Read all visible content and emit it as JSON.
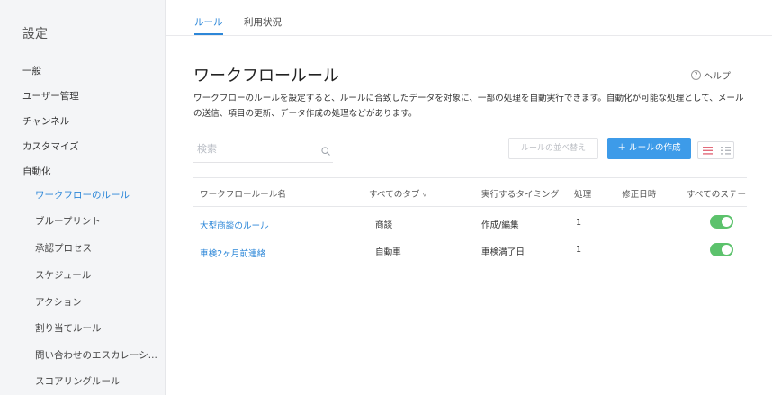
{
  "sidebar": {
    "title": "設定",
    "items": [
      {
        "label": "一般"
      },
      {
        "label": "ユーザー管理"
      },
      {
        "label": "チャンネル"
      },
      {
        "label": "カスタマイズ"
      },
      {
        "label": "自動化"
      }
    ],
    "sub_items": [
      {
        "label": "ワークフローのルール",
        "active": true
      },
      {
        "label": "ブループリント"
      },
      {
        "label": "承認プロセス"
      },
      {
        "label": "スケジュール"
      },
      {
        "label": "アクション"
      },
      {
        "label": "割り当てルール"
      },
      {
        "label": "問い合わせのエスカレーシ..."
      },
      {
        "label": "スコアリングルール"
      }
    ]
  },
  "tabs": [
    {
      "label": "ルール",
      "active": true
    },
    {
      "label": "利用状況"
    }
  ],
  "page": {
    "title": "ワークフロールール",
    "help_label": "ヘルプ",
    "help_icon": "?",
    "description": "ワークフローのルールを設定すると、ルールに合致したデータを対象に、一部の処理を自動実行できます。自動化が可能な処理として、メールの送信、項目の更新、データ作成の処理などがあります。"
  },
  "toolbar": {
    "search_placeholder": "検索",
    "sort_label": "ルールの並べ替え",
    "create_label": "＋ ルールの作成"
  },
  "table": {
    "headers": [
      "ワークフロールール名",
      "すべてのタブ ▿",
      "実行するタイミング",
      "処理",
      "修正日時",
      "すべてのステータス"
    ],
    "rows": [
      {
        "name": "大型商談のルール",
        "tab": "商談",
        "timing": "作成/編集",
        "actions": "1",
        "modified": "",
        "enabled": true
      },
      {
        "name": "車検2ヶ月前連絡",
        "tab": "自動車",
        "timing": "車検満了日",
        "actions": "1",
        "modified": "",
        "enabled": true
      }
    ]
  },
  "colors": {
    "accent": "#2d87d8",
    "button": "#3d9be9",
    "toggle_on": "#5cc26c"
  }
}
